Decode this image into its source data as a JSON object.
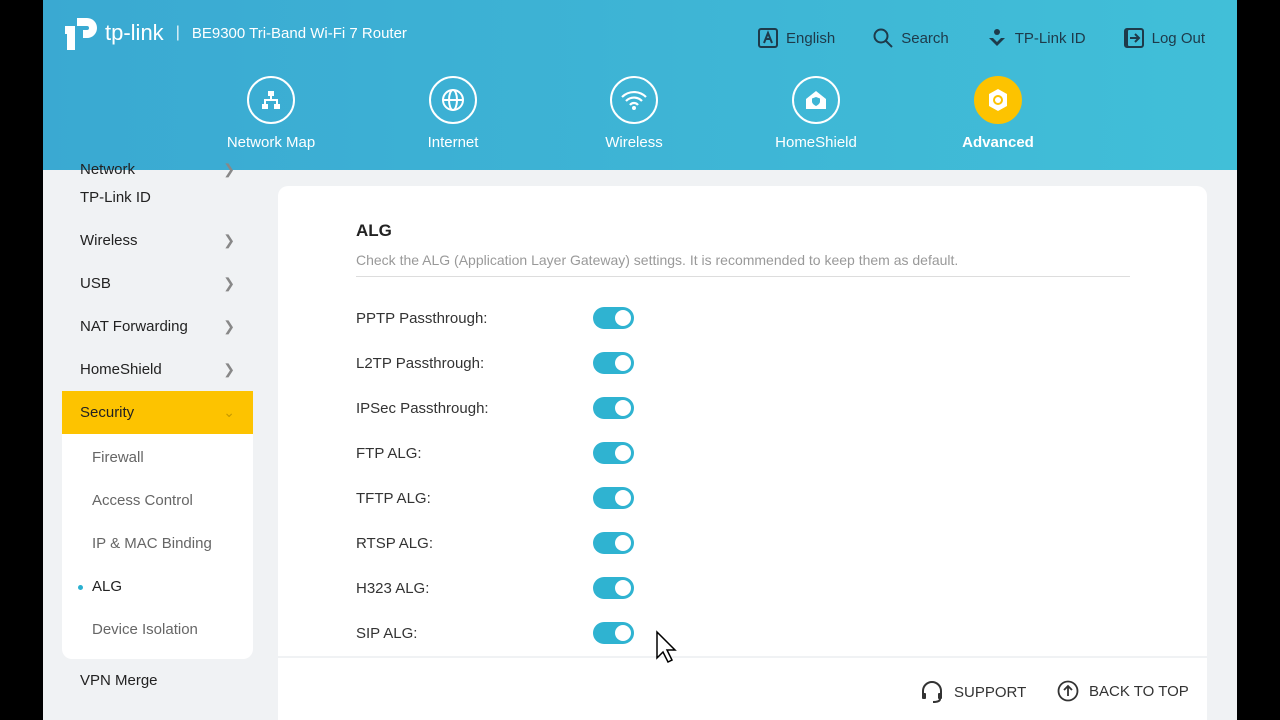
{
  "header": {
    "brand": "tp-link",
    "model": "BE9300 Tri-Band Wi-Fi 7 Router",
    "links": [
      {
        "label": "English",
        "icon": "language-icon"
      },
      {
        "label": "Search",
        "icon": "search-icon"
      },
      {
        "label": "TP-Link ID",
        "icon": "tplink-id-icon"
      },
      {
        "label": "Log Out",
        "icon": "logout-icon"
      }
    ],
    "nav": [
      {
        "label": "Network Map"
      },
      {
        "label": "Internet"
      },
      {
        "label": "Wireless"
      },
      {
        "label": "HomeShield"
      },
      {
        "label": "Advanced",
        "active": true
      }
    ],
    "accent": "#fdc300"
  },
  "sidebar": {
    "items": [
      "Network",
      "TP-Link ID",
      "Wireless",
      "USB",
      "NAT Forwarding",
      "HomeShield",
      "Security",
      "VPN Merge"
    ],
    "sub": [
      "Firewall",
      "Access Control",
      "IP & MAC Binding",
      "ALG",
      "Device Isolation"
    ]
  },
  "main": {
    "title": "ALG",
    "description": "Check the ALG (Application Layer Gateway) settings. It is recommended to keep them as default.",
    "settings": [
      {
        "label": "PPTP Passthrough:",
        "on": true
      },
      {
        "label": "L2TP Passthrough:",
        "on": true
      },
      {
        "label": "IPSec Passthrough:",
        "on": true
      },
      {
        "label": "FTP ALG:",
        "on": true
      },
      {
        "label": "TFTP ALG:",
        "on": true
      },
      {
        "label": "RTSP ALG:",
        "on": true
      },
      {
        "label": "H323 ALG:",
        "on": true
      },
      {
        "label": "SIP ALG:",
        "on": true
      }
    ]
  },
  "footer": {
    "support": "SUPPORT",
    "back_to_top": "BACK TO TOP"
  }
}
